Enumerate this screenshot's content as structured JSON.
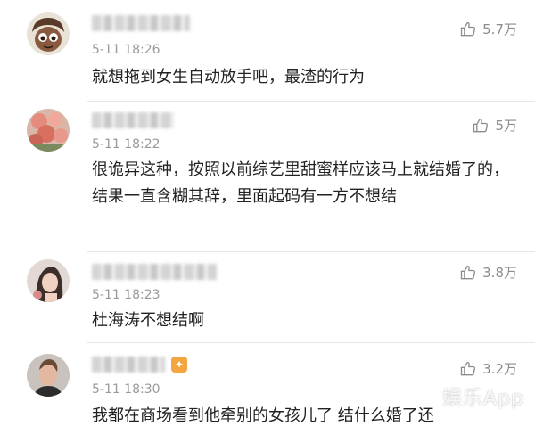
{
  "comments": [
    {
      "time": "5-11 18:26",
      "likes": "5.7万",
      "text": "就想拖到女生自动放手吧，最渣的行为",
      "avatar_icon": "cartoon-face-avatar"
    },
    {
      "time": "5-11 18:22",
      "likes": "5万",
      "text": "很诡异这种，按照以前综艺里甜蜜样应该马上就结婚了的，结果一直含糊其辞，里面起码有一方不想结",
      "avatar_icon": "flower-avatar"
    },
    {
      "time": "5-11 18:23",
      "likes": "3.8万",
      "text": "杜海涛不想结啊",
      "avatar_icon": "girl-photo-avatar"
    },
    {
      "time": "5-11 18:30",
      "likes": "3.2万",
      "text": "我都在商场看到他牵别的女孩儿了 结什么婚了还",
      "avatar_icon": "man-photo-avatar"
    }
  ],
  "watermark": "娱乐App",
  "colors": {
    "text": "#222222",
    "muted": "#9a9a9a",
    "divider": "#e6e6e6",
    "badge": "#f2a541"
  }
}
